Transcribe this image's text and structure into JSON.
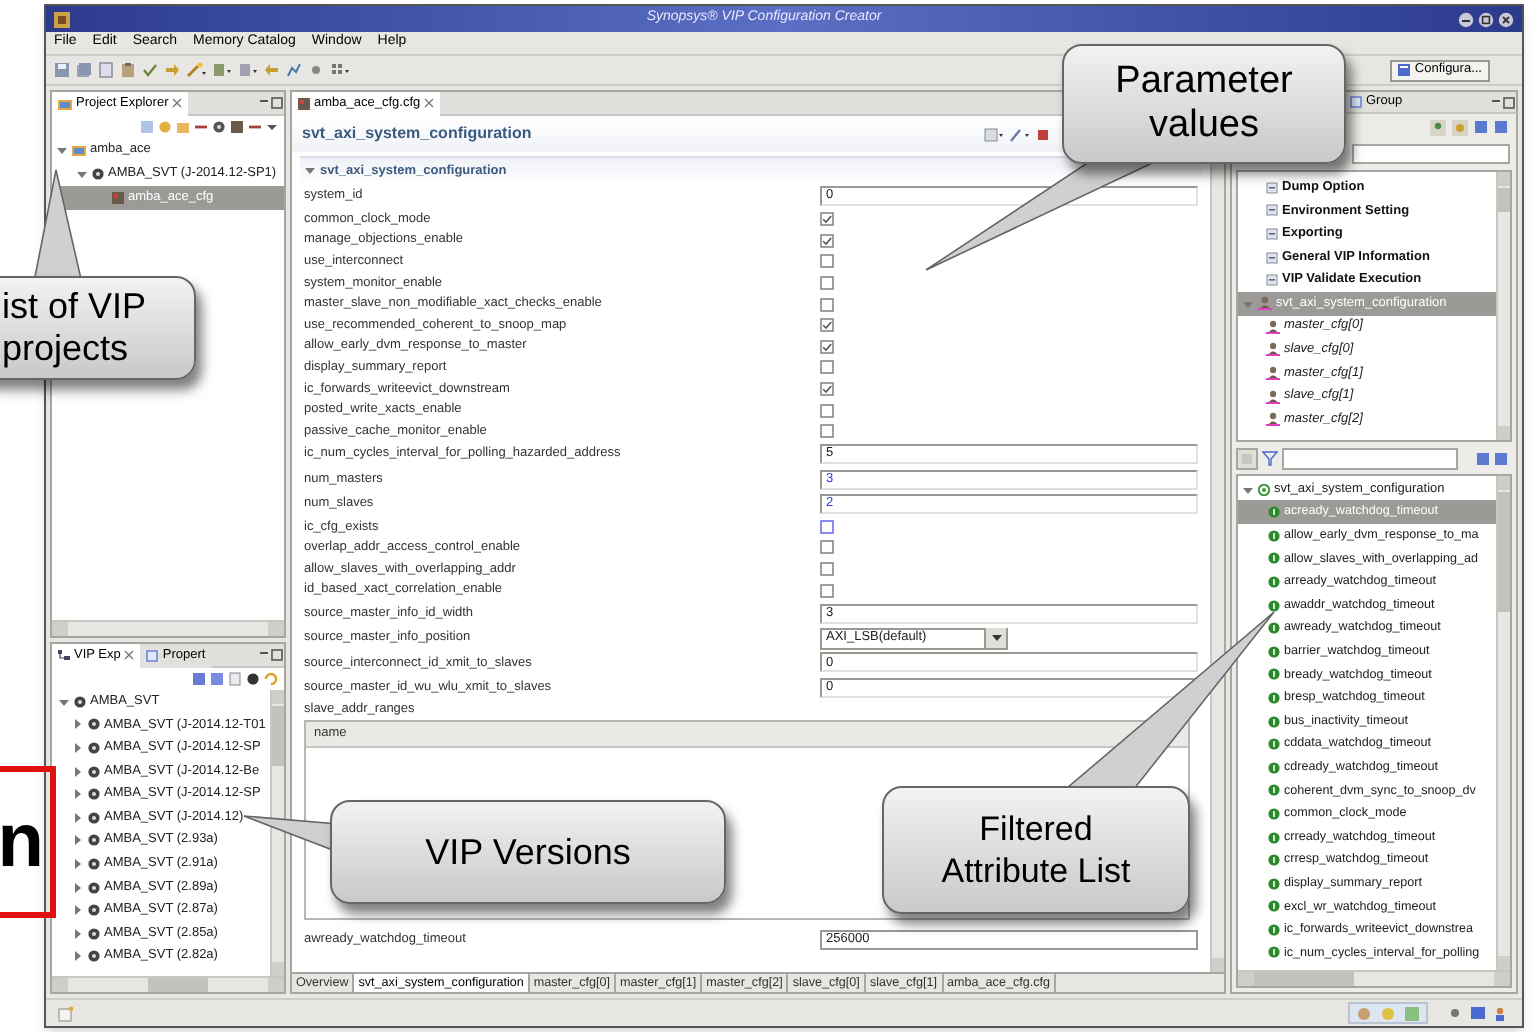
{
  "window": {
    "title": "Synopsys® VIP Configuration Creator"
  },
  "menu": [
    "File",
    "Edit",
    "Search",
    "Memory Catalog",
    "Window",
    "Help"
  ],
  "perspective_button": "Configura...",
  "project_explorer": {
    "tab": "Project Explorer",
    "tree": [
      {
        "label": "amba_ace",
        "expanded": true,
        "selected": false,
        "children": [
          {
            "label": "AMBA_SVT (J-2014.12-SP1)",
            "expanded": true,
            "selected": false,
            "children": [
              {
                "label": "amba_ace_cfg",
                "selected": true
              }
            ]
          }
        ]
      }
    ]
  },
  "vip_explorer": {
    "tabs": [
      {
        "label": "VIP Exp",
        "selected": true
      },
      {
        "label": "Propert",
        "selected": false
      }
    ],
    "tree": [
      {
        "label": "AMBA_SVT",
        "expanded": true,
        "children": [
          {
            "label": "AMBA_SVT (J-2014.12-T01",
            "expanded": false
          },
          {
            "label": "AMBA_SVT (J-2014.12-SP",
            "expanded": false
          },
          {
            "label": "AMBA_SVT (J-2014.12-Be",
            "expanded": false
          },
          {
            "label": "AMBA_SVT (J-2014.12-SP",
            "expanded": false
          },
          {
            "label": "AMBA_SVT (J-2014.12)",
            "expanded": false
          },
          {
            "label": "AMBA_SVT (2.93a)",
            "expanded": false
          },
          {
            "label": "AMBA_SVT (2.91a)",
            "expanded": false
          },
          {
            "label": "AMBA_SVT (2.89a)",
            "expanded": false
          },
          {
            "label": "AMBA_SVT (2.87a)",
            "expanded": false
          },
          {
            "label": "AMBA_SVT (2.85a)",
            "expanded": false
          },
          {
            "label": "AMBA_SVT (2.82a)",
            "expanded": false
          }
        ]
      }
    ]
  },
  "editor": {
    "tab": "amba_ace_cfg.cfg",
    "form_title": "svt_axi_system_configuration",
    "section": {
      "title": "svt_axi_system_configuration",
      "expanded": true
    },
    "params": [
      {
        "name": "system_id",
        "kind": "text",
        "value": "0",
        "modified": false
      },
      {
        "name": "common_clock_mode",
        "kind": "check",
        "checked": true,
        "modified": false
      },
      {
        "name": "manage_objections_enable",
        "kind": "check",
        "checked": true,
        "modified": false
      },
      {
        "name": "use_interconnect",
        "kind": "check",
        "checked": false,
        "modified": false
      },
      {
        "name": "system_monitor_enable",
        "kind": "check",
        "checked": false,
        "modified": false
      },
      {
        "name": "master_slave_non_modifiable_xact_checks_enable",
        "kind": "check",
        "checked": false,
        "modified": false
      },
      {
        "name": "use_recommended_coherent_to_snoop_map",
        "kind": "check",
        "checked": true,
        "modified": false
      },
      {
        "name": "allow_early_dvm_response_to_master",
        "kind": "check",
        "checked": true,
        "modified": false
      },
      {
        "name": "display_summary_report",
        "kind": "check",
        "checked": false,
        "modified": false
      },
      {
        "name": "ic_forwards_writeevict_downstream",
        "kind": "check",
        "checked": true,
        "modified": false
      },
      {
        "name": "posted_write_xacts_enable",
        "kind": "check",
        "checked": false,
        "modified": false
      },
      {
        "name": "passive_cache_monitor_enable",
        "kind": "check",
        "checked": false,
        "modified": false
      },
      {
        "name": "ic_num_cycles_interval_for_polling_hazarded_address",
        "kind": "text",
        "value": "5",
        "modified": false
      },
      {
        "name": "num_masters",
        "kind": "text",
        "value": "3",
        "modified": true
      },
      {
        "name": "num_slaves",
        "kind": "text",
        "value": "2",
        "modified": true
      },
      {
        "name": "ic_cfg_exists",
        "kind": "check",
        "checked": false,
        "modified": true
      },
      {
        "name": "overlap_addr_access_control_enable",
        "kind": "check",
        "checked": false,
        "modified": false
      },
      {
        "name": "allow_slaves_with_overlapping_addr",
        "kind": "check",
        "checked": false,
        "modified": false
      },
      {
        "name": "id_based_xact_correlation_enable",
        "kind": "check",
        "checked": false,
        "modified": false
      },
      {
        "name": "source_master_info_id_width",
        "kind": "text",
        "value": "3",
        "modified": false
      },
      {
        "name": "source_master_info_position",
        "kind": "dropdown",
        "value": "AXI_LSB(default)",
        "modified": false
      },
      {
        "name": "source_interconnect_id_xmit_to_slaves",
        "kind": "text",
        "value": "0",
        "modified": false
      },
      {
        "name": "source_master_id_wu_wlu_xmit_to_slaves",
        "kind": "text",
        "value": "0",
        "modified": false
      },
      {
        "name": "slave_addr_ranges",
        "kind": "table",
        "columns": [
          "name"
        ]
      }
    ],
    "after_table": [
      {
        "name": "awready_watchdog_timeout",
        "value": "256000"
      }
    ],
    "bottom_tabs": [
      {
        "label": "Overview",
        "selected": false
      },
      {
        "label": "svt_axi_system_configuration",
        "selected": true
      },
      {
        "label": "master_cfg[0]",
        "selected": false
      },
      {
        "label": "master_cfg[1]",
        "selected": false
      },
      {
        "label": "master_cfg[2]",
        "selected": false
      },
      {
        "label": "slave_cfg[0]",
        "selected": false
      },
      {
        "label": "slave_cfg[1]",
        "selected": false
      },
      {
        "label": "amba_ace_cfg.cfg",
        "selected": false
      }
    ]
  },
  "right_panel": {
    "tab": "Group",
    "categories": [
      "Dump Option",
      "Environment Setting",
      "Exporting",
      "General VIP Information",
      "VIP Validate Execution"
    ],
    "config_tree": {
      "label": "svt_axi_system_configuration",
      "expanded": true,
      "selected": true,
      "children": [
        {
          "label": "master_cfg[0]",
          "selected": false
        },
        {
          "label": "slave_cfg[0]",
          "selected": false
        },
        {
          "label": "master_cfg[1]",
          "selected": false
        },
        {
          "label": "slave_cfg[1]",
          "selected": false
        },
        {
          "label": "master_cfg[2]",
          "selected": false
        }
      ]
    },
    "attribute_tree": {
      "label": "svt_axi_system_configuration",
      "expanded": true,
      "children": [
        {
          "label": "acready_watchdog_timeout",
          "selected": true
        },
        {
          "label": "allow_early_dvm_response_to_ma",
          "selected": false
        },
        {
          "label": "allow_slaves_with_overlapping_ad",
          "selected": false
        },
        {
          "label": "arready_watchdog_timeout",
          "selected": false
        },
        {
          "label": "awaddr_watchdog_timeout",
          "selected": false
        },
        {
          "label": "awready_watchdog_timeout",
          "selected": false
        },
        {
          "label": "barrier_watchdog_timeout",
          "selected": false
        },
        {
          "label": "bready_watchdog_timeout",
          "selected": false
        },
        {
          "label": "bresp_watchdog_timeout",
          "selected": false
        },
        {
          "label": "bus_inactivity_timeout",
          "selected": false
        },
        {
          "label": "cddata_watchdog_timeout",
          "selected": false
        },
        {
          "label": "cdready_watchdog_timeout",
          "selected": false
        },
        {
          "label": "coherent_dvm_sync_to_snoop_dv",
          "selected": false
        },
        {
          "label": "common_clock_mode",
          "selected": false
        },
        {
          "label": "crready_watchdog_timeout",
          "selected": false
        },
        {
          "label": "crresp_watchdog_timeout",
          "selected": false
        },
        {
          "label": "display_summary_report",
          "selected": false
        },
        {
          "label": "excl_wr_watchdog_timeout",
          "selected": false
        },
        {
          "label": "ic_forwards_writeevict_downstrea",
          "selected": false
        },
        {
          "label": "ic_num_cycles_interval_for_polling",
          "selected": false
        }
      ]
    }
  },
  "callouts": [
    {
      "text": "Parameter values"
    },
    {
      "text": "ist of VIP projects"
    },
    {
      "text": "VIP Versions"
    },
    {
      "text": "Filtered Attribute List"
    }
  ],
  "slide_fragment": {
    "text": "n"
  }
}
